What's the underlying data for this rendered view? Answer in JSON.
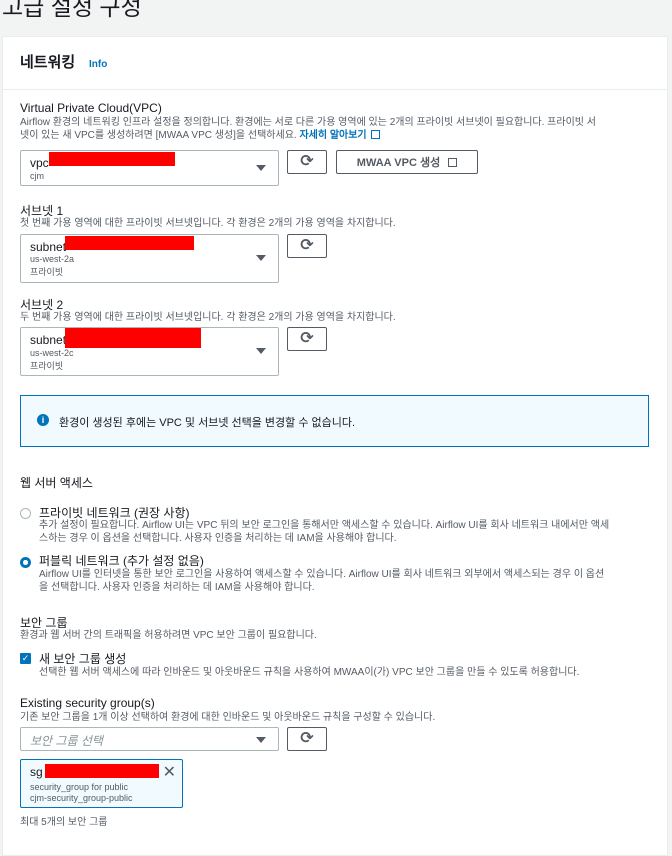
{
  "page_title": "고급 설정 구성",
  "panel": {
    "title": "네트워킹",
    "info_label": "Info"
  },
  "vpc": {
    "label": "Virtual Private Cloud(VPC)",
    "desc_line1": "Airflow 환경의 네트워킹 인프라 설정을 정의합니다. 환경에는 서로 다른 가용 영역에 있는 2개의 프라이빗 서브넷이 필요합니다. 프라이빗 서",
    "desc_line2": "넷이 있는 새 VPC를 생성하려면 [MWAA VPC 생성]을 선택하세요.",
    "learn_more": "자세히 알아보기",
    "selected_main": "vpc",
    "selected_sub": "cjm",
    "create_button": "MWAA VPC 생성"
  },
  "subnet1": {
    "label": "서브넷 1",
    "desc": "첫 번째 가용 영역에 대한 프라이빗 서브넷입니다. 각 환경은 2개의 가용 영역을 차지합니다.",
    "selected_main": "subnet",
    "selected_az": "us-west-2a",
    "selected_type": "프라이빗"
  },
  "subnet2": {
    "label": "서브넷 2",
    "desc": "두 번째 가용 영역에 대한 프라이빗 서브넷입니다. 각 환경은 2개의 가용 영역을 차지합니다.",
    "selected_main": "subnet",
    "selected_az": "us-west-2c",
    "selected_type": "프라이빗"
  },
  "alert": {
    "icon": "info-icon",
    "text": "환경이 생성된 후에는 VPC 및 서브넷 선택을 변경할 수 없습니다."
  },
  "web_access": {
    "label": "웹 서버 액세스",
    "options": [
      {
        "title": "프라이빗 네트워크 (권장 사항)",
        "desc_line1": "추가 설정이 필요합니다. Airflow UI는 VPC 뒤의 보안 로그인을 통해서만 액세스할 수 있습니다. Airflow UI를 회사 네트워크 내에서만 액세",
        "desc_line2": "스하는 경우 이 옵션을 선택합니다. 사용자 인증을 처리하는 데 IAM을 사용해야 합니다.",
        "checked": false
      },
      {
        "title": "퍼블릭 네트워크 (추가 설정 없음)",
        "desc_line1": "Airflow UI를 인터넷을 통한 보안 로그인을 사용하여 액세스할 수 있습니다. Airflow UI를 회사 네트워크 외부에서 액세스되는 경우 이 옵션",
        "desc_line2": "을 선택합니다. 사용자 인증을 처리하는 데 IAM을 사용해야 합니다.",
        "checked": true
      }
    ]
  },
  "security_group": {
    "label": "보안 그룹",
    "desc": "환경과 웹 서버 간의 트래픽을 허용하려면 VPC 보안 그룹이 필요합니다.",
    "checkbox_label": "새 보안 그룹 생성",
    "checkbox_desc": "선택한 웹 서버 액세스에 따라 인바운드 및 아웃바운드 규칙을 사용하여 MWAA이(가) VPC 보안 그룹을 만들 수 있도록 허용합니다.",
    "checked": true
  },
  "existing_sg": {
    "label": "Existing security group(s)",
    "desc": "기존 보안 그룹을 1개 이상 선택하여 환경에 대한 인바운드 및 아웃바운드 규칙을 구성할 수 있습니다.",
    "placeholder": "보안 그룹 선택",
    "token_main": "sg",
    "token_sub1": "security_group for public",
    "token_sub2": "cjm-security_group-public",
    "limit_note": "최대 5개의 보안 그룹"
  },
  "colors": {
    "accent": "#0073bb",
    "redaction": "#ff0000"
  }
}
